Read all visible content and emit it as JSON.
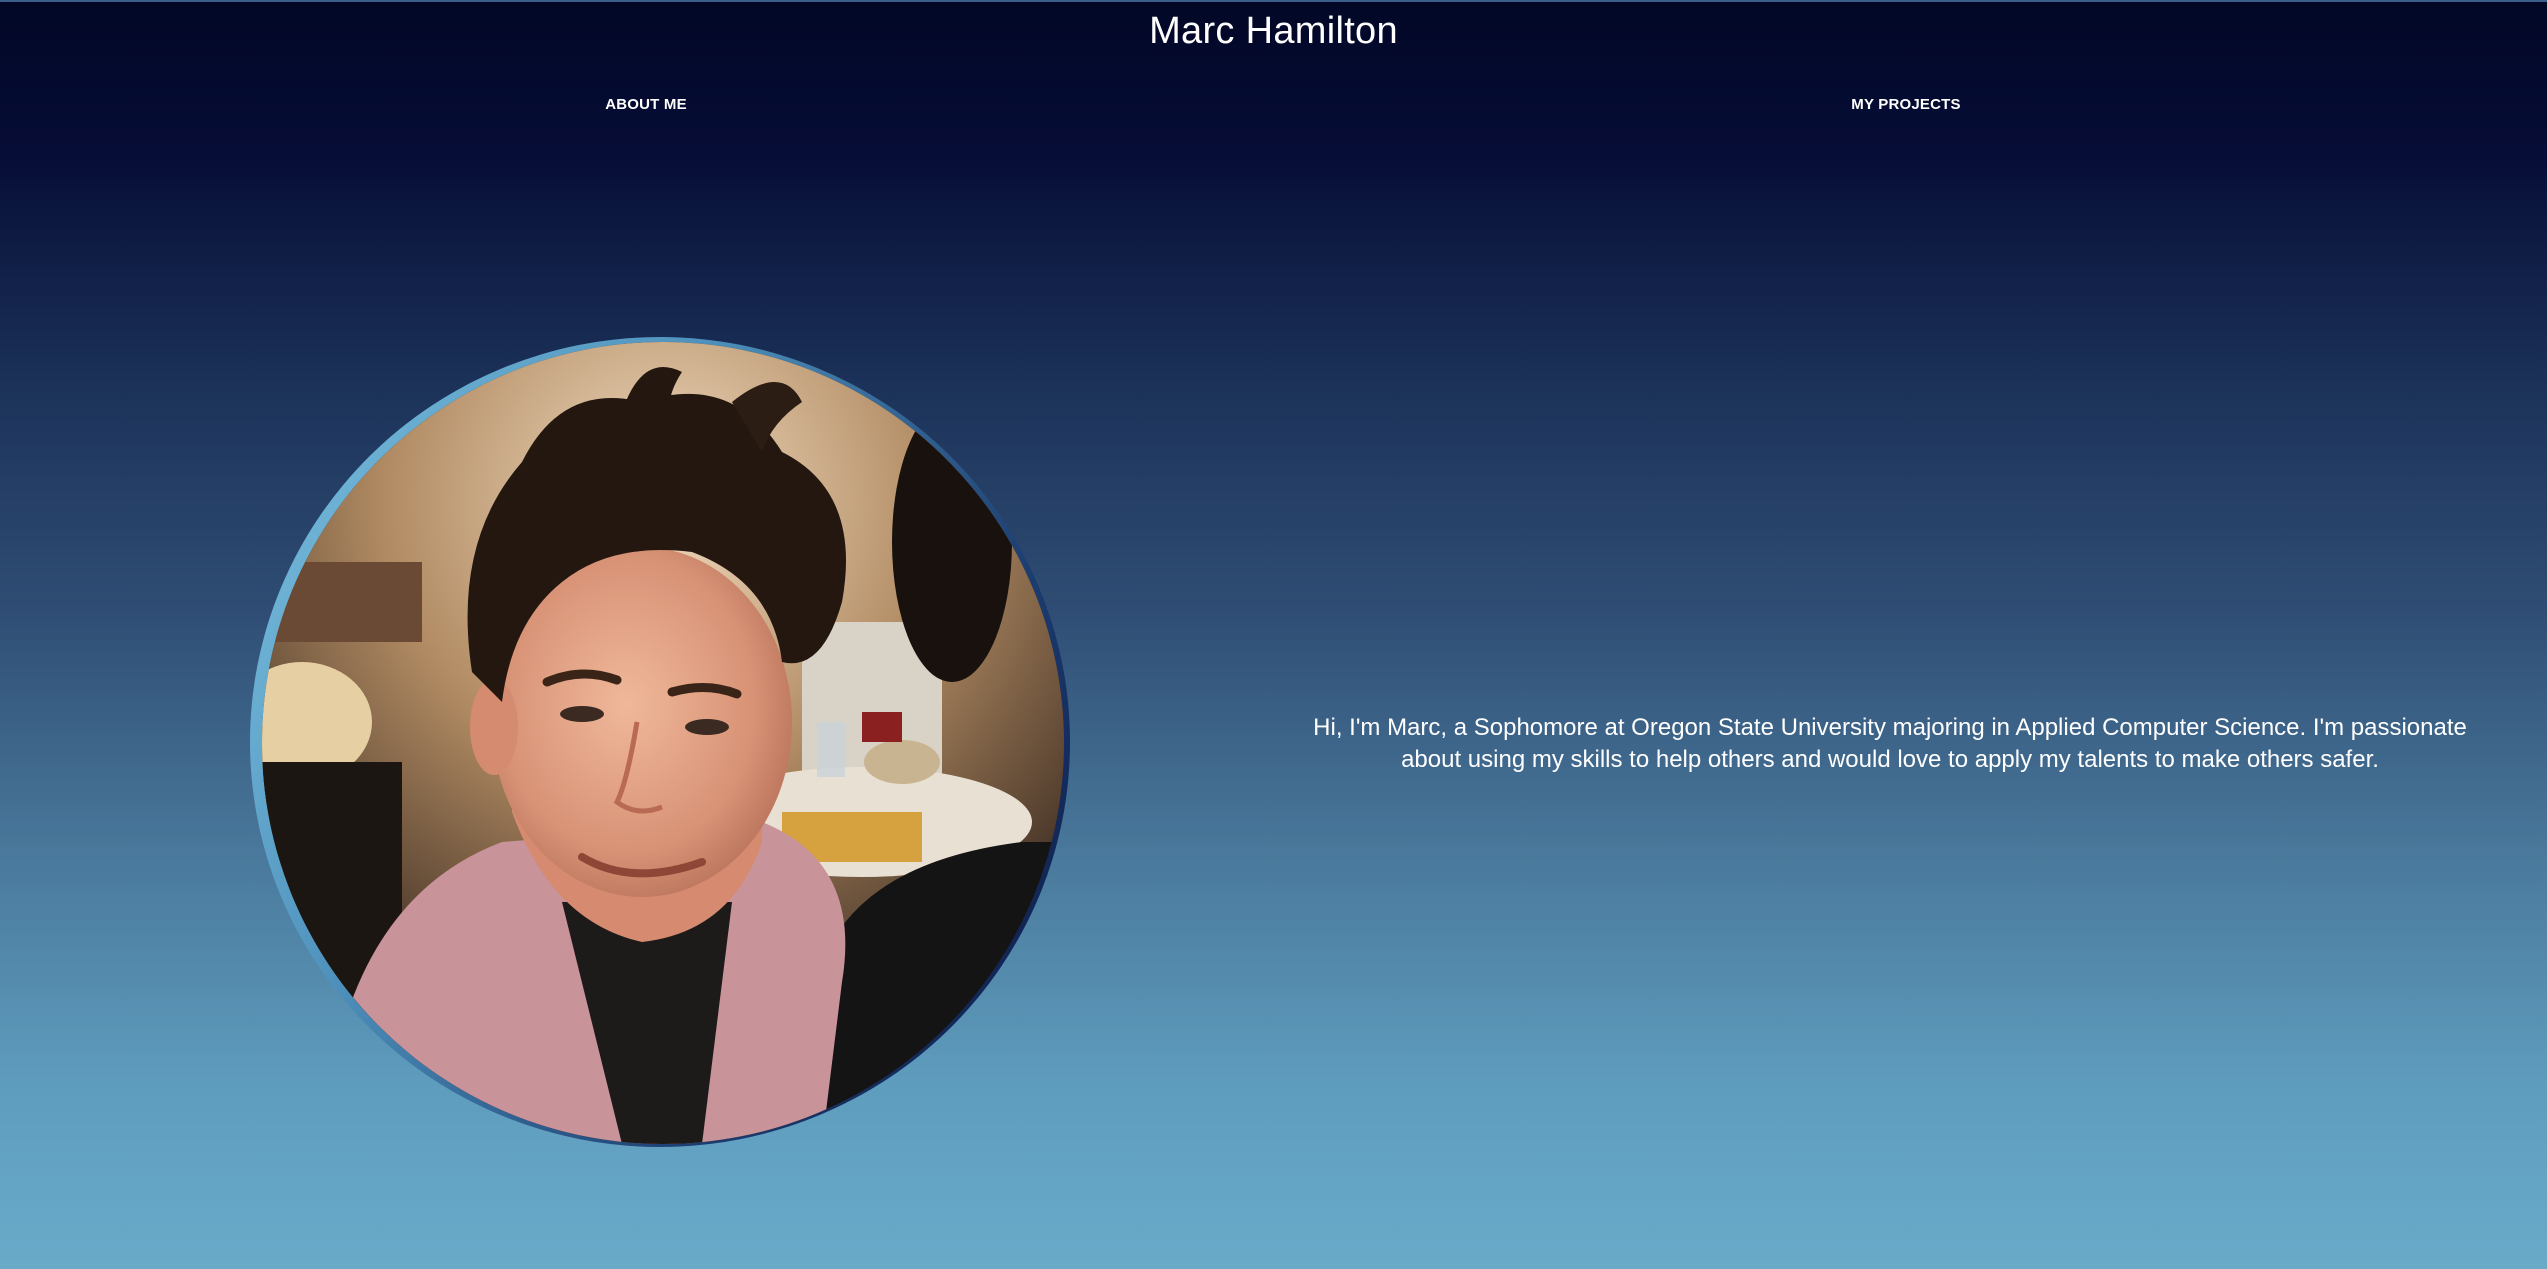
{
  "header": {
    "title": "Marc Hamilton"
  },
  "nav": {
    "items": [
      {
        "label": "ABOUT ME"
      },
      {
        "label": "MY PROJECTS"
      }
    ]
  },
  "profile": {
    "photo_alt": "Portrait photo of Marc Hamilton",
    "bio": "Hi, I'm Marc, a Sophomore at Oregon State University majoring in Applied Computer Science. I'm passionate about using my skills to help others and would love to apply my talents to make others safer."
  },
  "colors": {
    "gradient_top": "#020726",
    "gradient_bottom": "#69aac9",
    "text": "#ffffff",
    "ring_light": "#7fc4e2",
    "ring_dark": "#071240"
  }
}
